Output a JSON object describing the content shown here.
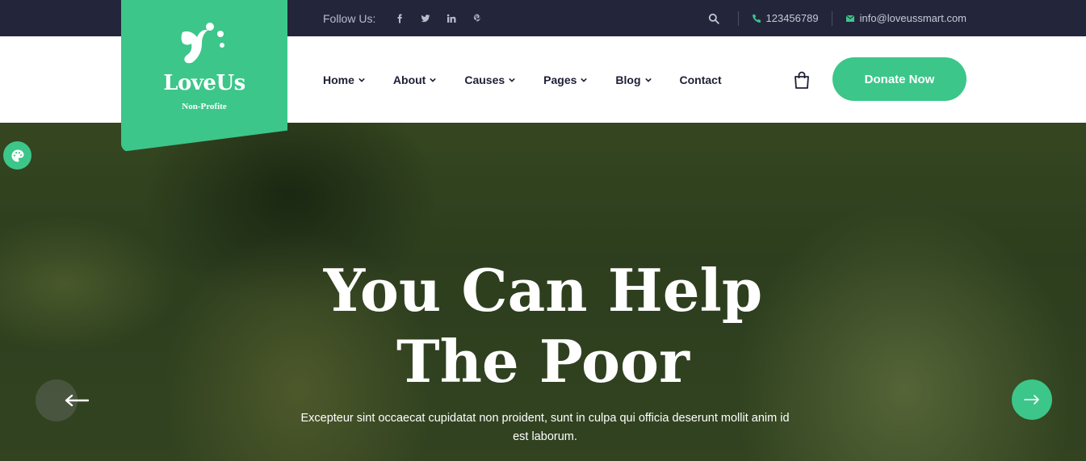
{
  "topbar": {
    "follow_label": "Follow Us:",
    "social": [
      "facebook-icon",
      "twitter-icon",
      "linkedin-icon",
      "pinterest-icon"
    ],
    "phone": "123456789",
    "email": "info@loveussmart.com"
  },
  "logo": {
    "name": "LoveUs",
    "tagline": "Non-Profite"
  },
  "nav": {
    "items": [
      {
        "label": "Home",
        "has_dropdown": true
      },
      {
        "label": "About",
        "has_dropdown": true
      },
      {
        "label": "Causes",
        "has_dropdown": true
      },
      {
        "label": "Pages",
        "has_dropdown": true
      },
      {
        "label": "Blog",
        "has_dropdown": true
      },
      {
        "label": "Contact",
        "has_dropdown": false
      }
    ],
    "donate_label": "Donate Now"
  },
  "hero": {
    "title_line1": "You Can Help",
    "title_line2": "The Poor",
    "description": "Excepteur sint occaecat cupidatat non proident, sunt in culpa qui officia deserunt mollit anim id est laborum."
  },
  "colors": {
    "accent": "#3cc68a",
    "topbar_bg": "#23263b",
    "nav_text": "#1d2035"
  }
}
